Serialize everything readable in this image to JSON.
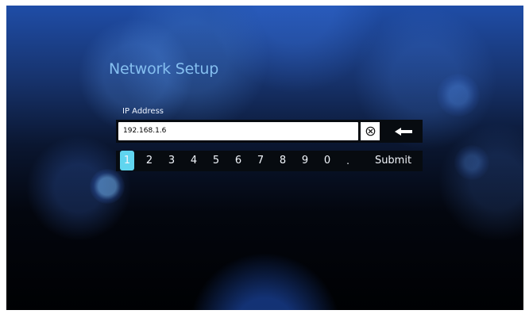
{
  "screen": {
    "title": "Network Setup"
  },
  "form": {
    "ip_label": "IP Address",
    "ip_value": "192.168.1.6",
    "clear_icon": "clear-icon",
    "backspace_icon": "back-arrow-icon"
  },
  "keyboard": {
    "selected_key": "1",
    "keys": [
      "1",
      "2",
      "3",
      "4",
      "5",
      "6",
      "7",
      "8",
      "9",
      "0",
      ".",
      "Submit"
    ]
  },
  "colors": {
    "accent": "#85bff0",
    "selected_key": "#60d5ef",
    "input_background": "#ffffff",
    "keyboard_background": "#070b10"
  }
}
